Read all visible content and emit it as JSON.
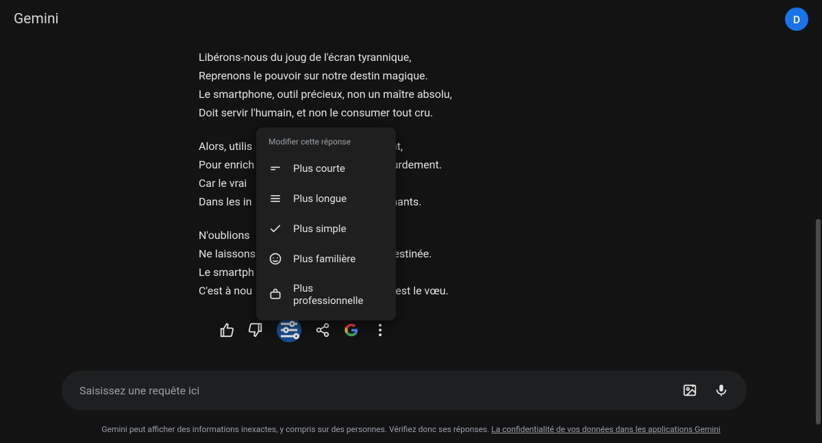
{
  "header": {
    "app_title": "Gemini",
    "avatar_initial": "D"
  },
  "response": {
    "stanzas": [
      [
        "Libérons-nous du joug de l'écran tyrannique,",
        "Reprenons le pouvoir sur notre destin magique.",
        "Le smartphone, outil précieux, non un maître absolu,",
        "Doit servir l'humain, et non le consumer tout cru."
      ],
      [
        "Alors, utilis                                         nement,",
        "Pour enrich                                            r sourdement.",
        "Car le vrai                                             cran,",
        "Dans les in                                            es chants."
      ],
      [
        "N'oublions                                             iité,",
        "Ne laissons                                            re destinée.",
        "Le smartph",
        "C'est à nou                                            se, c'est le vœu."
      ]
    ]
  },
  "actions": {
    "thumbs_up": "thumbs-up",
    "thumbs_down": "thumbs-down",
    "tune": "tune",
    "share": "share",
    "google": "google",
    "more": "more"
  },
  "modify_menu": {
    "title": "Modifier cette réponse",
    "items": [
      {
        "label": "Plus courte"
      },
      {
        "label": "Plus longue"
      },
      {
        "label": "Plus simple"
      },
      {
        "label": "Plus familière"
      },
      {
        "label": "Plus professionnelle"
      }
    ]
  },
  "prompt": {
    "placeholder": "Saisissez une requête ici"
  },
  "disclaimer": {
    "text_before": "Gemini peut afficher des informations inexactes, y compris sur des personnes. Vérifiez donc ses réponses. ",
    "link_text": "La confidentialité de vos données dans les applications Gemini"
  }
}
